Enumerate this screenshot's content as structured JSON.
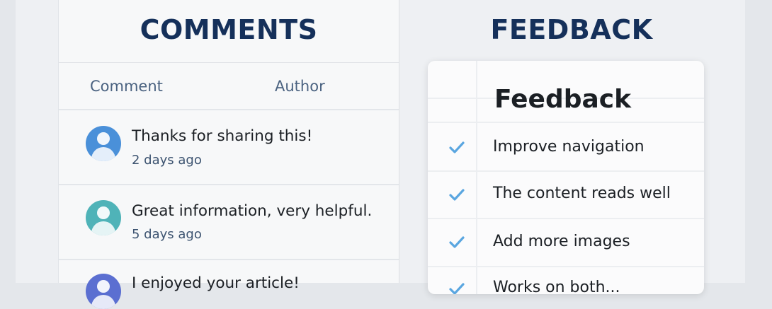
{
  "comments": {
    "title": "COMMENTS",
    "columns": {
      "comment": "Comment",
      "author": "Author"
    },
    "items": [
      {
        "text": "Thanks for sharing this!",
        "time": "2 days ago",
        "avatar_color": "#4a90d9"
      },
      {
        "text": "Great information, very helpful.",
        "time": "5 days ago",
        "avatar_color": "#4fb3b8"
      },
      {
        "text": "I enjoyed your article!",
        "time": "",
        "avatar_color": "#5b6fd1"
      }
    ]
  },
  "feedback": {
    "title": "FEEDBACK",
    "heading": "Feedback",
    "items": [
      {
        "label": "Improve navigation",
        "icon": "check-icon"
      },
      {
        "label": "The content reads well",
        "icon": "check-icon"
      },
      {
        "label": "Add more images",
        "icon": "check-icon"
      },
      {
        "label": "Works on both...",
        "icon": "check-icon"
      }
    ],
    "check_color": "#5aa6e0"
  },
  "colors": {
    "title": "#15305a",
    "background": "#eef0f3"
  }
}
